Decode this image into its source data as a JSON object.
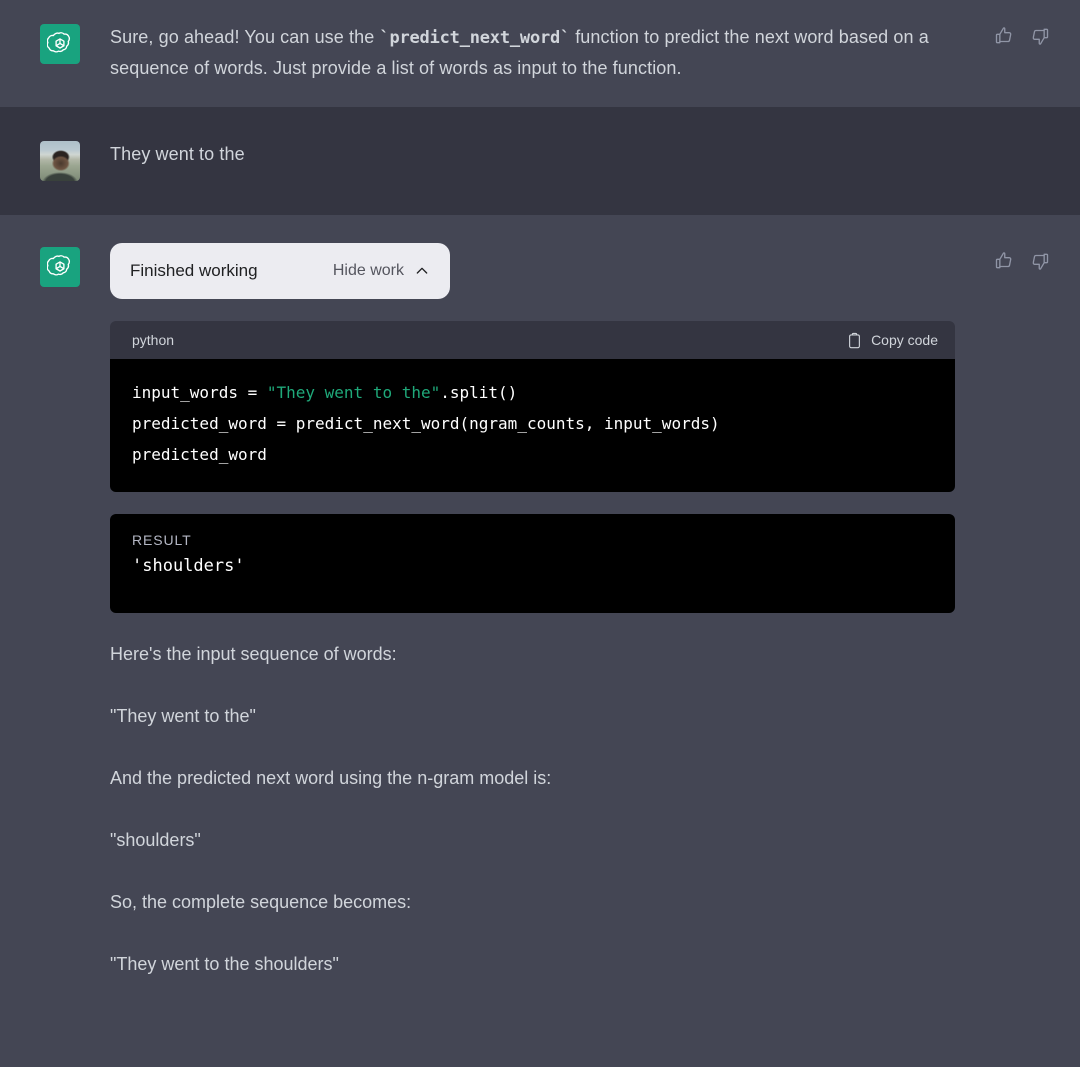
{
  "messages": {
    "assistant_first": {
      "avatar_icon": "openai-logo-icon",
      "avatar_color": "#19A37F",
      "text_before_code": "Sure, go ahead! You can use the ",
      "inline_code": "`predict_next_word`",
      "text_after_code": " function to predict the next word based on a sequence of words. Just provide a list of words as input to the function.",
      "thumbs_up_icon": "thumbs-up-icon",
      "thumbs_down_icon": "thumbs-down-icon"
    },
    "user": {
      "avatar_icon": "user-photo-avatar",
      "text": "They went to the"
    },
    "assistant_second": {
      "avatar_icon": "openai-logo-icon",
      "work_panel": {
        "title": "Finished working",
        "toggle_label": "Hide work",
        "chevron_icon": "chevron-up-icon",
        "background": "#ECECF1"
      },
      "code_block": {
        "language": "python",
        "copy_label": "Copy code",
        "copy_icon": "clipboard-icon",
        "line1_prefix": "input_words = ",
        "line1_string": "\"They went to the\"",
        "line1_suffix": ".split()",
        "line2": "predicted_word = predict_next_word(ngram_counts, input_words)",
        "line3": "predicted_word",
        "string_color": "#1FA97A"
      },
      "result_block": {
        "label": "RESULT",
        "value": "'shoulders'"
      },
      "paragraphs": [
        "Here's the input sequence of words:",
        "\"They went to the\"",
        "And the predicted next word using the n-gram model is:",
        "\"shoulders\"",
        "So, the complete sequence becomes:",
        "\"They went to the shoulders\""
      ],
      "thumbs_up_icon": "thumbs-up-icon",
      "thumbs_down_icon": "thumbs-down-icon"
    }
  },
  "theme": {
    "assistant_bg": "#444654",
    "user_bg": "#343541",
    "text_color": "#D1D5DB",
    "code_bg": "#000000"
  }
}
